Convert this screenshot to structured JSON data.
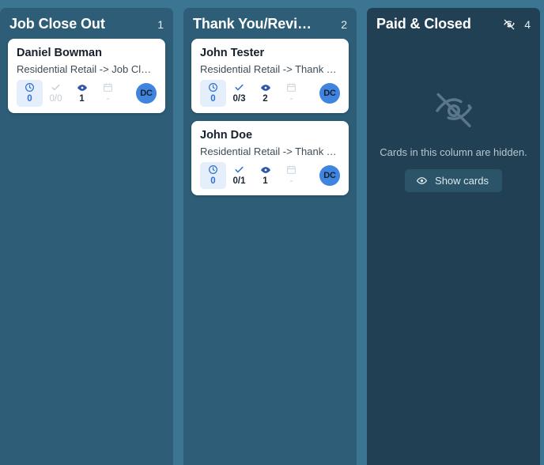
{
  "board": {
    "columns": [
      {
        "title": "Job Close Out",
        "count": "1",
        "hidden": false,
        "cards": [
          {
            "title": "Daniel Bowman",
            "subtitle": "Residential Retail -> Job Close Out",
            "meta": {
              "time_value": "0",
              "tasks_value": "0/0",
              "views_value": "1",
              "date_value": "-"
            },
            "avatar_initials": "DC"
          }
        ]
      },
      {
        "title": "Thank You/Revi…",
        "count": "2",
        "hidden": false,
        "cards": [
          {
            "title": "John Tester",
            "subtitle": "Residential Retail -> Thank You E…",
            "meta": {
              "time_value": "0",
              "tasks_value": "0/3",
              "views_value": "2",
              "date_value": "-"
            },
            "avatar_initials": "DC"
          },
          {
            "title": "John Doe",
            "subtitle": "Residential Retail -> Thank You E…",
            "meta": {
              "time_value": "0",
              "tasks_value": "0/1",
              "views_value": "1",
              "date_value": "-"
            },
            "avatar_initials": "DC"
          }
        ]
      },
      {
        "title": "Paid & Closed",
        "count": "4",
        "hidden": true,
        "hidden_message": "Cards in this column are hidden.",
        "show_cards_label": "Show cards",
        "cards": []
      }
    ]
  },
  "icons": {
    "clock": "clock-icon",
    "check": "check-icon",
    "eye": "eye-icon",
    "calendar": "calendar-icon",
    "eye_off": "eye-off-icon"
  },
  "colors": {
    "page_background": "#3c7591",
    "column_background": "#2d5d77",
    "hidden_column_background": "#214054",
    "card_background": "#ffffff",
    "accent_blue": "#2f6fd0",
    "avatar_blue": "#3f85e0",
    "highlight_badge": "#e5effb"
  }
}
